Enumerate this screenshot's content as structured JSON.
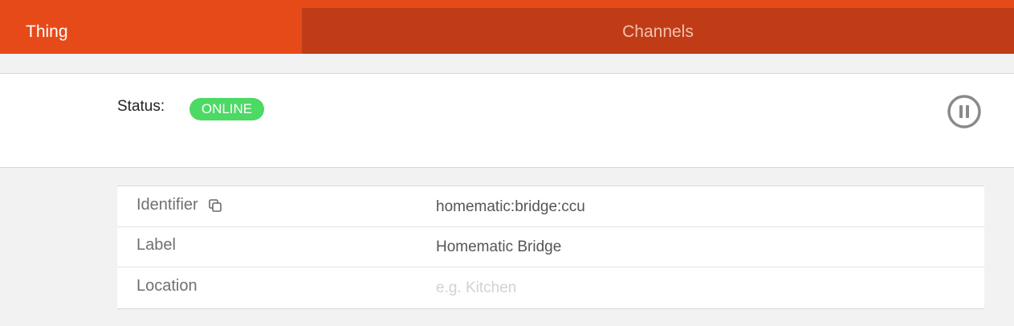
{
  "tabs": {
    "thing_label": "Thing",
    "channels_label": "Channels"
  },
  "status": {
    "label": "Status:",
    "value": "ONLINE",
    "pause_icon": "pause-circle-icon"
  },
  "properties": {
    "identifier_label": "Identifier",
    "identifier_value": "homematic:bridge:ccu",
    "copy_icon": "copy-icon",
    "label_label": "Label",
    "label_value": "Homematic Bridge",
    "location_label": "Location",
    "location_value": "",
    "location_placeholder": "e.g. Kitchen"
  },
  "colors": {
    "accent": "#e64a19",
    "tab_inactive": "#bf3c17",
    "online_badge": "#4cd964"
  }
}
